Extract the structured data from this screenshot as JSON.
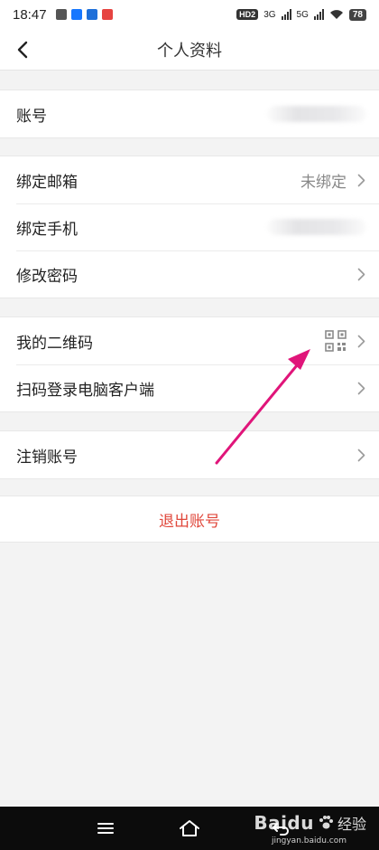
{
  "status_bar": {
    "time": "18:47",
    "network_hd": "HD2",
    "network_1": "3G",
    "network_2": "5G",
    "battery": "78"
  },
  "header": {
    "title": "个人资料",
    "back_icon": "chevron-left-icon"
  },
  "groups": [
    {
      "rows": [
        {
          "label": "账号",
          "value": "",
          "value_blurred": true,
          "chevron": false
        }
      ]
    },
    {
      "rows": [
        {
          "label": "绑定邮箱",
          "value": "未绑定",
          "value_blurred": false,
          "chevron": true
        },
        {
          "label": "绑定手机",
          "value": "",
          "value_blurred": true,
          "chevron": false
        },
        {
          "label": "修改密码",
          "value": "",
          "value_blurred": false,
          "chevron": true
        }
      ]
    },
    {
      "rows": [
        {
          "label": "我的二维码",
          "value": "",
          "icon": "qr-code-icon",
          "chevron": true
        },
        {
          "label": "扫码登录电脑客户端",
          "value": "",
          "chevron": true
        }
      ]
    },
    {
      "rows": [
        {
          "label": "注销账号",
          "value": "",
          "chevron": true
        }
      ]
    }
  ],
  "logout": {
    "label": "退出账号"
  },
  "nav_bar": {
    "icons": [
      "menu-icon",
      "home-icon",
      "back-icon"
    ]
  },
  "watermark": {
    "brand": "Baidu",
    "jy": "经验",
    "sub": "jingyan.baidu.com"
  },
  "colors": {
    "accent_red": "#e0483c",
    "annotation_arrow": "#e0157a"
  }
}
